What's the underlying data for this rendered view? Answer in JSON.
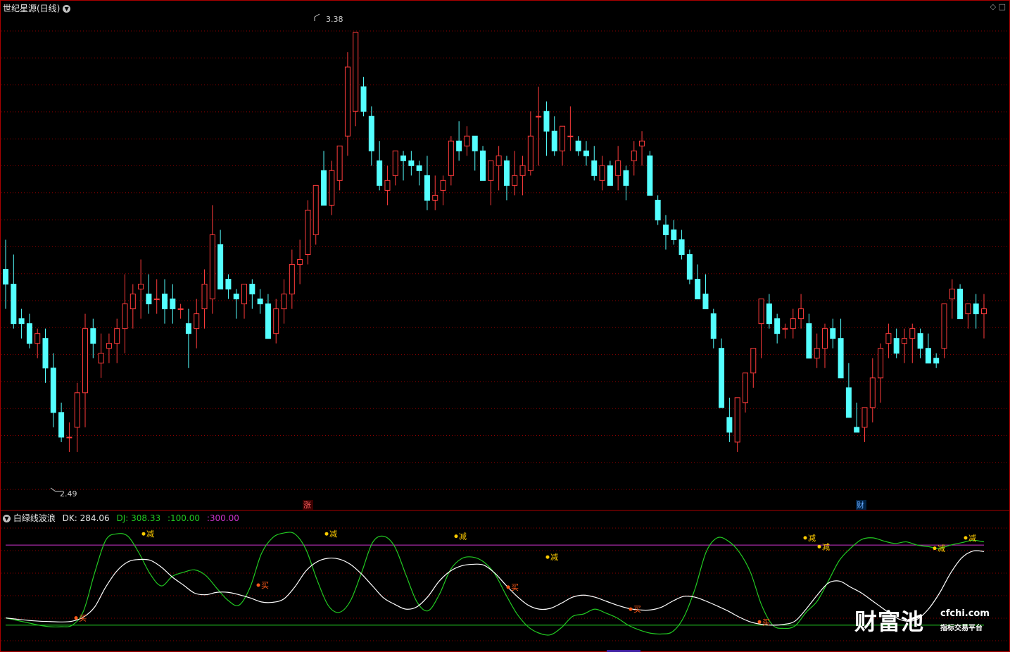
{
  "main_chart": {
    "title": "世纪星源(日线)",
    "high_label": "3.38",
    "low_label": "2.49",
    "marker_zhang": "涨",
    "marker_cai": "财",
    "icons": [
      "collapse-icon",
      "diamond-icon",
      "square-icon"
    ]
  },
  "indicator": {
    "name": "白绿线波浪",
    "dk_label": "DK:",
    "dk_value": "284.06",
    "dj_label": "DJ:",
    "dj_value": "308.33",
    "line1_value": ":100.00",
    "line2_value": ":300.00",
    "buy_label": "买",
    "reduce_label": "减"
  },
  "watermark": {
    "brand": "财富池",
    "domain": "cfchi.com",
    "slogan": "指标交易平台"
  },
  "colors": {
    "up": "#ff3b3b",
    "down": "#54ffff",
    "grid": "#8b0000",
    "white_line": "#ffffff",
    "green_line": "#22c922",
    "purple_line": "#cc33cc",
    "buy_marker": "#ff5a1a",
    "reduce_marker": "#ffcc00"
  },
  "chart_data": [
    {
      "type": "candlestick",
      "title": "世纪星源(日线)",
      "ylim": [
        2.45,
        3.42
      ],
      "candles": [
        [
          2.9,
          2.96,
          2.82,
          2.87
        ],
        [
          2.87,
          2.93,
          2.78,
          2.79
        ],
        [
          2.8,
          2.82,
          2.76,
          2.79
        ],
        [
          2.79,
          2.81,
          2.74,
          2.75
        ],
        [
          2.75,
          2.78,
          2.72,
          2.77
        ],
        [
          2.76,
          2.78,
          2.67,
          2.7
        ],
        [
          2.7,
          2.73,
          2.58,
          2.61
        ],
        [
          2.61,
          2.63,
          2.55,
          2.56
        ],
        [
          2.56,
          2.59,
          2.53,
          2.56
        ],
        [
          2.58,
          2.67,
          2.53,
          2.65
        ],
        [
          2.65,
          2.81,
          2.58,
          2.78
        ],
        [
          2.78,
          2.8,
          2.72,
          2.75
        ],
        [
          2.71,
          2.77,
          2.68,
          2.73
        ],
        [
          2.74,
          2.77,
          2.71,
          2.75
        ],
        [
          2.75,
          2.8,
          2.71,
          2.78
        ],
        [
          2.78,
          2.89,
          2.73,
          2.83
        ],
        [
          2.82,
          2.87,
          2.78,
          2.85
        ],
        [
          2.86,
          2.92,
          2.8,
          2.87
        ],
        [
          2.85,
          2.89,
          2.81,
          2.83
        ],
        [
          2.84,
          2.88,
          2.81,
          2.84
        ],
        [
          2.85,
          2.88,
          2.79,
          2.82
        ],
        [
          2.84,
          2.87,
          2.79,
          2.82
        ],
        [
          2.82,
          2.83,
          2.8,
          2.82
        ],
        [
          2.79,
          2.82,
          2.7,
          2.77
        ],
        [
          2.78,
          2.84,
          2.74,
          2.81
        ],
        [
          2.82,
          2.9,
          2.78,
          2.87
        ],
        [
          2.84,
          3.03,
          2.81,
          2.97
        ],
        [
          2.95,
          2.98,
          2.86,
          2.86
        ],
        [
          2.88,
          2.89,
          2.84,
          2.86
        ],
        [
          2.85,
          2.86,
          2.8,
          2.84
        ],
        [
          2.83,
          2.87,
          2.8,
          2.87
        ],
        [
          2.87,
          2.88,
          2.82,
          2.85
        ],
        [
          2.84,
          2.86,
          2.81,
          2.83
        ],
        [
          2.83,
          2.85,
          2.76,
          2.76
        ],
        [
          2.77,
          2.84,
          2.75,
          2.82
        ],
        [
          2.82,
          2.88,
          2.79,
          2.85
        ],
        [
          2.85,
          2.94,
          2.82,
          2.91
        ],
        [
          2.91,
          2.96,
          2.87,
          2.92
        ],
        [
          2.93,
          3.04,
          2.91,
          3.02
        ],
        [
          2.97,
          3.07,
          2.95,
          3.07
        ],
        [
          3.1,
          3.14,
          3.04,
          3.03
        ],
        [
          3.03,
          3.12,
          3.01,
          3.1
        ],
        [
          3.08,
          3.14,
          3.06,
          3.15
        ],
        [
          3.17,
          3.34,
          3.13,
          3.31
        ],
        [
          3.22,
          3.38,
          3.19,
          3.38
        ],
        [
          3.27,
          3.29,
          3.21,
          3.22
        ],
        [
          3.21,
          3.23,
          3.11,
          3.14
        ],
        [
          3.12,
          3.16,
          3.06,
          3.07
        ],
        [
          3.06,
          3.11,
          3.03,
          3.08
        ],
        [
          3.09,
          3.14,
          3.07,
          3.14
        ],
        [
          3.13,
          3.14,
          3.08,
          3.12
        ],
        [
          3.12,
          3.14,
          3.09,
          3.11
        ],
        [
          3.11,
          3.12,
          3.07,
          3.1
        ],
        [
          3.09,
          3.13,
          3.02,
          3.04
        ],
        [
          3.04,
          3.09,
          3.02,
          3.05
        ],
        [
          3.06,
          3.09,
          3.03,
          3.08
        ],
        [
          3.09,
          3.17,
          3.07,
          3.16
        ],
        [
          3.16,
          3.2,
          3.12,
          3.14
        ],
        [
          3.15,
          3.19,
          3.13,
          3.17
        ],
        [
          3.17,
          3.17,
          3.1,
          3.14
        ],
        [
          3.14,
          3.15,
          3.08,
          3.08
        ],
        [
          3.08,
          3.12,
          3.03,
          3.12
        ],
        [
          3.11,
          3.15,
          3.06,
          3.13
        ],
        [
          3.12,
          3.13,
          3.04,
          3.07
        ],
        [
          3.07,
          3.14,
          3.05,
          3.09
        ],
        [
          3.09,
          3.13,
          3.05,
          3.11
        ],
        [
          3.1,
          3.22,
          3.09,
          3.17
        ],
        [
          3.21,
          3.27,
          3.11,
          3.21
        ],
        [
          3.22,
          3.24,
          3.13,
          3.18
        ],
        [
          3.18,
          3.21,
          3.13,
          3.14
        ],
        [
          3.14,
          3.18,
          3.11,
          3.19
        ],
        [
          3.17,
          3.23,
          3.14,
          3.17
        ],
        [
          3.16,
          3.17,
          3.13,
          3.14
        ],
        [
          3.14,
          3.16,
          3.11,
          3.13
        ],
        [
          3.12,
          3.15,
          3.08,
          3.09
        ],
        [
          3.08,
          3.13,
          3.06,
          3.11
        ],
        [
          3.11,
          3.12,
          3.07,
          3.07
        ],
        [
          3.09,
          3.15,
          3.06,
          3.12
        ],
        [
          3.1,
          3.11,
          3.04,
          3.07
        ],
        [
          3.12,
          3.16,
          3.09,
          3.14
        ],
        [
          3.15,
          3.18,
          3.11,
          3.16
        ],
        [
          3.13,
          3.14,
          3.05,
          3.05
        ],
        [
          3.04,
          3.05,
          2.99,
          3.0
        ],
        [
          2.99,
          3.01,
          2.94,
          2.97
        ],
        [
          2.98,
          3.0,
          2.95,
          2.96
        ],
        [
          2.96,
          2.98,
          2.92,
          2.93
        ],
        [
          2.93,
          2.94,
          2.87,
          2.88
        ],
        [
          2.88,
          2.91,
          2.84,
          2.84
        ],
        [
          2.85,
          2.89,
          2.83,
          2.82
        ],
        [
          2.81,
          2.82,
          2.74,
          2.76
        ],
        [
          2.74,
          2.76,
          2.64,
          2.62
        ],
        [
          2.6,
          2.64,
          2.55,
          2.57
        ],
        [
          2.55,
          2.62,
          2.53,
          2.64
        ],
        [
          2.63,
          2.68,
          2.61,
          2.69
        ],
        [
          2.69,
          2.73,
          2.66,
          2.74
        ],
        [
          2.79,
          2.82,
          2.72,
          2.84
        ],
        [
          2.83,
          2.85,
          2.78,
          2.79
        ],
        [
          2.8,
          2.81,
          2.75,
          2.77
        ],
        [
          2.78,
          2.79,
          2.76,
          2.78
        ],
        [
          2.78,
          2.82,
          2.76,
          2.8
        ],
        [
          2.8,
          2.85,
          2.78,
          2.82
        ],
        [
          2.79,
          2.81,
          2.72,
          2.72
        ],
        [
          2.72,
          2.77,
          2.7,
          2.74
        ],
        [
          2.74,
          2.79,
          2.7,
          2.78
        ],
        [
          2.78,
          2.8,
          2.74,
          2.76
        ],
        [
          2.76,
          2.8,
          2.7,
          2.68
        ],
        [
          2.66,
          2.71,
          2.62,
          2.6
        ],
        [
          2.58,
          2.63,
          2.57,
          2.57
        ],
        [
          2.58,
          2.62,
          2.55,
          2.62
        ],
        [
          2.62,
          2.72,
          2.59,
          2.68
        ],
        [
          2.68,
          2.75,
          2.63,
          2.74
        ],
        [
          2.75,
          2.79,
          2.72,
          2.77
        ],
        [
          2.76,
          2.78,
          2.72,
          2.73
        ],
        [
          2.75,
          2.78,
          2.71,
          2.76
        ],
        [
          2.76,
          2.79,
          2.71,
          2.78
        ],
        [
          2.77,
          2.78,
          2.72,
          2.74
        ],
        [
          2.74,
          2.77,
          2.72,
          2.71
        ],
        [
          2.72,
          2.73,
          2.7,
          2.71
        ],
        [
          2.74,
          2.83,
          2.72,
          2.83
        ],
        [
          2.84,
          2.88,
          2.8,
          2.86
        ],
        [
          2.86,
          2.87,
          2.8,
          2.8
        ],
        [
          2.81,
          2.82,
          2.78,
          2.83
        ],
        [
          2.83,
          2.85,
          2.78,
          2.81
        ],
        [
          2.81,
          2.85,
          2.76,
          2.82
        ]
      ]
    },
    {
      "type": "line",
      "title": "白绿线波浪",
      "ylim": [
        40,
        360
      ],
      "reference_lines": [
        100,
        300
      ],
      "series": [
        {
          "name": "DK",
          "values": [
            118,
            115,
            112,
            110,
            109,
            108,
            110,
            120,
            145,
            195,
            235,
            258,
            264,
            262,
            245,
            220,
            200,
            180,
            176,
            182,
            182,
            176,
            168,
            158,
            157,
            165,
            195,
            235,
            258,
            267,
            265,
            252,
            228,
            198,
            168,
            152,
            140,
            146,
            172,
            210,
            235,
            248,
            252,
            250,
            230,
            200,
            172,
            150,
            140,
            142,
            155,
            170,
            175,
            170,
            160,
            150,
            142,
            138,
            138,
            145,
            160,
            172,
            170,
            160,
            148,
            135,
            120,
            108,
            102,
            100,
            102,
            110,
            140,
            175,
            205,
            210,
            195,
            180,
            160,
            140,
            120,
            110,
            115,
            140,
            180,
            230,
            268,
            285,
            284
          ]
        },
        {
          "name": "DJ",
          "values": [
            118,
            112,
            106,
            100,
            96,
            96,
            100,
            135,
            230,
            312,
            328,
            322,
            280,
            228,
            198,
            222,
            232,
            238,
            224,
            192,
            162,
            150,
            195,
            278,
            318,
            330,
            328,
            290,
            214,
            150,
            132,
            160,
            230,
            306,
            322,
            296,
            226,
            158,
            136,
            176,
            238,
            266,
            270,
            258,
            228,
            176,
            128,
            96,
            80,
            76,
            94,
            122,
            128,
            140,
            130,
            118,
            100,
            88,
            80,
            78,
            84,
            120,
            190,
            282,
            318,
            310,
            282,
            232,
            150,
            100,
            92,
            98,
            132,
            160,
            210,
            262,
            292,
            314,
            318,
            310,
            304,
            308,
            300,
            296,
            292,
            300,
            306,
            312,
            308
          ]
        }
      ],
      "signals": [
        {
          "label": "买",
          "value": 118
        },
        {
          "label": "减",
          "value": 328
        },
        {
          "label": "减",
          "value": 328
        },
        {
          "label": "买",
          "value": 200
        },
        {
          "label": "减",
          "value": 322
        },
        {
          "label": "买",
          "value": 195
        },
        {
          "label": "减",
          "value": 270
        },
        {
          "label": "买",
          "value": 140
        },
        {
          "label": "买",
          "value": 108
        },
        {
          "label": "减",
          "value": 318
        },
        {
          "label": "减",
          "value": 296
        },
        {
          "label": "减",
          "value": 292
        },
        {
          "label": "减",
          "value": 318
        }
      ]
    }
  ]
}
